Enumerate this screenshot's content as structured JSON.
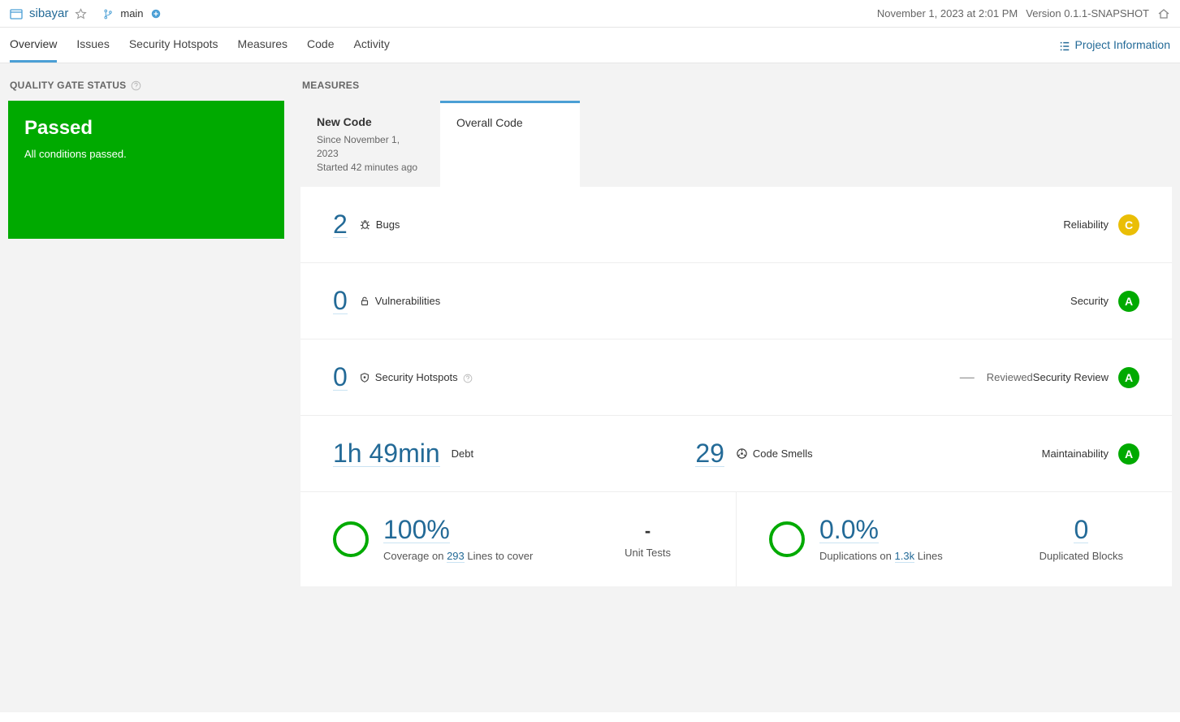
{
  "header": {
    "project_name": "sibayar",
    "branch_name": "main",
    "timestamp": "November 1, 2023 at 2:01 PM",
    "version": "Version 0.1.1-SNAPSHOT"
  },
  "nav": {
    "items": [
      "Overview",
      "Issues",
      "Security Hotspots",
      "Measures",
      "Code",
      "Activity"
    ],
    "active": "Overview",
    "project_info": "Project Information"
  },
  "sidebar": {
    "qgs_title": "QUALITY GATE STATUS",
    "status": "Passed",
    "subtitle": "All conditions passed."
  },
  "main_title": "MEASURES",
  "tabs": {
    "new_code": {
      "title": "New Code",
      "since": "Since November 1, 2023",
      "started": "Started 42 minutes ago"
    },
    "overall_code": {
      "title": "Overall Code"
    }
  },
  "metrics": {
    "bugs": {
      "value": "2",
      "label": "Bugs",
      "rating_label": "Reliability",
      "rating": "C"
    },
    "vulns": {
      "value": "0",
      "label": "Vulnerabilities",
      "rating_label": "Security",
      "rating": "A"
    },
    "hotspots": {
      "value": "0",
      "label": "Security Hotspots",
      "reviewed_dash": "—",
      "reviewed_label": "Reviewed",
      "rating_label": "Security Review",
      "rating": "A"
    },
    "debt": {
      "value": "1h 49min",
      "label": "Debt"
    },
    "smells": {
      "value": "29",
      "label": "Code Smells",
      "rating_label": "Maintainability",
      "rating": "A"
    },
    "coverage": {
      "value": "100%",
      "prefix": "Coverage on ",
      "lines": "293",
      "suffix": " Lines to cover"
    },
    "unit_tests": {
      "value": "-",
      "label": "Unit Tests"
    },
    "dup": {
      "value": "0.0%",
      "prefix": "Duplications on ",
      "lines": "1.3k",
      "suffix": " Lines"
    },
    "dup_blocks": {
      "value": "0",
      "label": "Duplicated Blocks"
    }
  }
}
